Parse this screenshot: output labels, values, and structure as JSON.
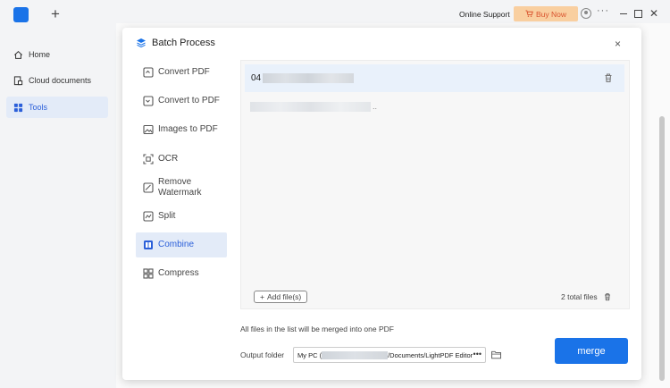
{
  "titlebar": {
    "new_tab": "+",
    "online_support": "Online Support",
    "buy_now": "Buy Now",
    "more": "···",
    "close": "✕"
  },
  "sidebar": {
    "items": [
      {
        "label": "Home",
        "icon": "home-icon"
      },
      {
        "label": "Cloud documents",
        "icon": "cloud-documents-icon"
      },
      {
        "label": "Tools",
        "icon": "tools-icon"
      }
    ],
    "active": "Tools"
  },
  "dialog": {
    "title": "Batch Process",
    "close": "×",
    "tools": [
      {
        "label": "Convert PDF",
        "icon": "convert-pdf-icon"
      },
      {
        "label": "Convert to PDF",
        "icon": "convert-to-pdf-icon"
      },
      {
        "label": "Images to PDF",
        "icon": "images-to-pdf-icon"
      },
      {
        "label": "OCR",
        "icon": "ocr-icon"
      },
      {
        "label": "Remove Watermark",
        "icon": "remove-watermark-icon"
      },
      {
        "label": "Split",
        "icon": "split-icon"
      },
      {
        "label": "Combine",
        "icon": "combine-icon"
      },
      {
        "label": "Compress",
        "icon": "compress-icon"
      }
    ],
    "active_tool": "Combine",
    "file_list": {
      "first_file_prefix": "04",
      "second_file_suffix": ".."
    },
    "add_files_label": "Add file(s)",
    "total_files": "2 total files",
    "merge_note": "All files in the list will be merged into one PDF",
    "output_folder_label": "Output folder",
    "output_folder_value_prefix": "My PC (",
    "output_folder_value_suffix": "/Documents/LightPDF Editor",
    "output_more": "•••",
    "merge_button": "merge"
  },
  "colors": {
    "accent": "#1a73e8",
    "active_bg": "#e3ebf8",
    "buy_now_bg": "#f9cfa0",
    "buy_now_text": "#d9532e"
  }
}
